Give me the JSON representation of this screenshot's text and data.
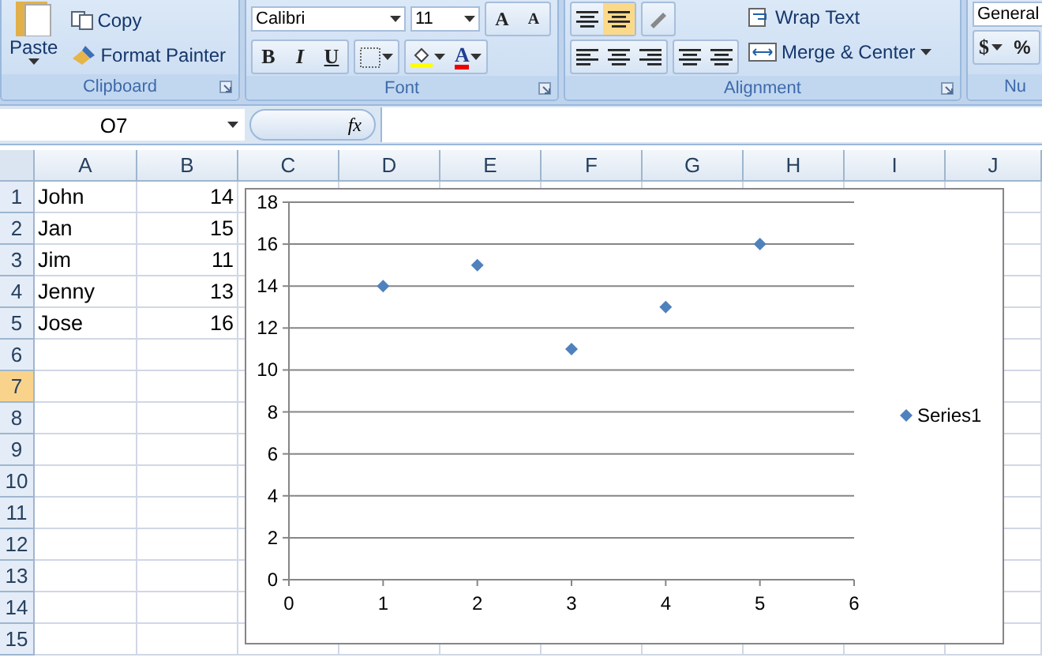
{
  "ribbon": {
    "clipboard": {
      "label": "Clipboard",
      "paste": "Paste",
      "copy": "Copy",
      "format_painter": "Format Painter"
    },
    "font": {
      "label": "Font",
      "font_name": "Calibri",
      "font_size": "11",
      "grow": "A",
      "shrink": "A",
      "bold": "B",
      "italic": "I",
      "underline": "U",
      "font_color": "A"
    },
    "alignment": {
      "label": "Alignment",
      "wrap_text": "Wrap Text",
      "merge_center": "Merge & Center"
    },
    "number": {
      "label": "Nu",
      "format": "General",
      "currency": "$",
      "percent": "%"
    }
  },
  "formula_bar": {
    "name_box": "O7",
    "fx": "fx"
  },
  "columns": [
    {
      "label": "A",
      "selected": false
    },
    {
      "label": "B",
      "selected": false
    },
    {
      "label": "C",
      "selected": false
    },
    {
      "label": "D",
      "selected": false
    },
    {
      "label": "E",
      "selected": false
    },
    {
      "label": "F",
      "selected": false
    },
    {
      "label": "G",
      "selected": false
    },
    {
      "label": "H",
      "selected": false
    },
    {
      "label": "I",
      "selected": false
    },
    {
      "label": "J",
      "selected": false
    }
  ],
  "rows": [
    {
      "label": "1",
      "selected": false,
      "a": "John",
      "b": "14"
    },
    {
      "label": "2",
      "selected": false,
      "a": "Jan",
      "b": "15"
    },
    {
      "label": "3",
      "selected": false,
      "a": "Jim",
      "b": "11"
    },
    {
      "label": "4",
      "selected": false,
      "a": "Jenny",
      "b": "13"
    },
    {
      "label": "5",
      "selected": false,
      "a": "Jose",
      "b": "16"
    },
    {
      "label": "6",
      "selected": false
    },
    {
      "label": "7",
      "selected": true
    },
    {
      "label": "8",
      "selected": false
    },
    {
      "label": "9",
      "selected": false
    },
    {
      "label": "10",
      "selected": false
    },
    {
      "label": "11",
      "selected": false
    },
    {
      "label": "12",
      "selected": false
    },
    {
      "label": "13",
      "selected": false
    },
    {
      "label": "14",
      "selected": false
    },
    {
      "label": "15",
      "selected": false
    }
  ],
  "chart": {
    "chart_data": {
      "type": "scatter",
      "grid": true,
      "x": [
        1,
        2,
        3,
        4,
        5
      ],
      "series": [
        {
          "name": "Series1",
          "color": "#4f81bd",
          "values": [
            14,
            15,
            11,
            13,
            16
          ]
        }
      ],
      "xlim": [
        0,
        6
      ],
      "ylim": [
        0,
        18
      ],
      "xticks": [
        0,
        1,
        2,
        3,
        4,
        5,
        6
      ],
      "yticks": [
        0,
        2,
        4,
        6,
        8,
        10,
        12,
        14,
        16,
        18
      ]
    }
  }
}
